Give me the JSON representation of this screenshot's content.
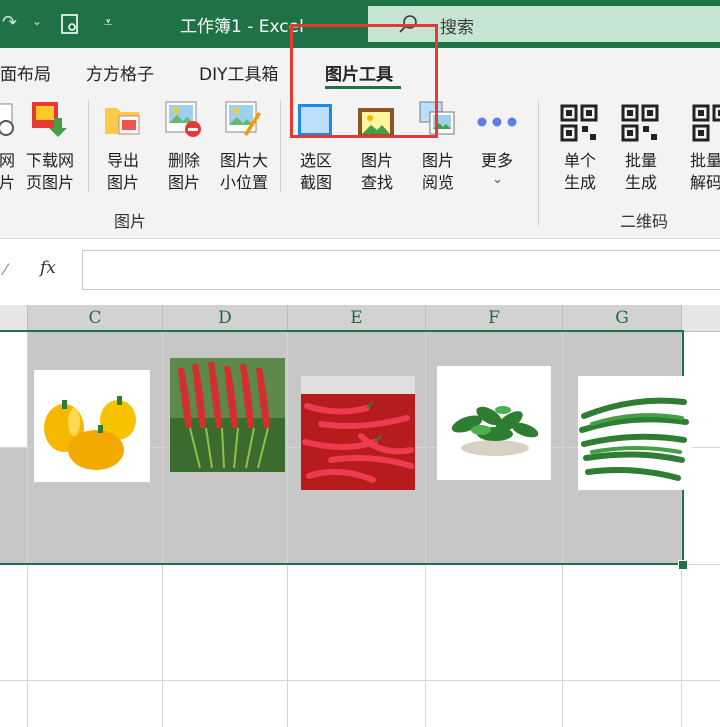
{
  "titlebar": {
    "title": "工作簿1  -  Excel",
    "search_placeholder": "搜索"
  },
  "tabs": [
    {
      "label": "面布局"
    },
    {
      "label": "方方格子"
    },
    {
      "label": "DIY工具箱"
    },
    {
      "label": "图片工具",
      "active": true
    }
  ],
  "ribbon": {
    "buttons": [
      {
        "label": "网\n片",
        "icon": "web-image-icon"
      },
      {
        "label": "下载网\n页图片",
        "icon": "download-image-icon"
      },
      {
        "label": "导出\n图片",
        "icon": "folder-export-icon"
      },
      {
        "label": "删除\n图片",
        "icon": "image-delete-icon"
      },
      {
        "label": "图片大\n小位置",
        "icon": "image-resize-icon"
      },
      {
        "label": "选区\n截图",
        "icon": "screenshot-icon"
      },
      {
        "label": "图片\n查找",
        "icon": "image-find-icon"
      },
      {
        "label": "图片\n阅览",
        "icon": "image-preview-icon"
      },
      {
        "label": "更多",
        "icon": "more-dots-icon"
      },
      {
        "label": "单个\n生成",
        "icon": "qrcode-icon"
      },
      {
        "label": "批量\n生成",
        "icon": "qrcode-icon"
      },
      {
        "label": "批量\n解码",
        "icon": "qrcode-icon"
      }
    ],
    "groups": {
      "images": "图片",
      "qrcode": "二维码"
    }
  },
  "formula_bar": {
    "fx": "fx",
    "value": ""
  },
  "columns": [
    "C",
    "D",
    "E",
    "F",
    "G"
  ],
  "pictures": [
    {
      "name": "yellow-peppers"
    },
    {
      "name": "red-chili-bunch"
    },
    {
      "name": "red-chilies-pile"
    },
    {
      "name": "green-peppers-bowl"
    },
    {
      "name": "long-green-chilies"
    }
  ],
  "colors": {
    "excel_green": "#1f7246",
    "highlight_red": "#e53935",
    "selection_fill": "#c7c7c7"
  }
}
